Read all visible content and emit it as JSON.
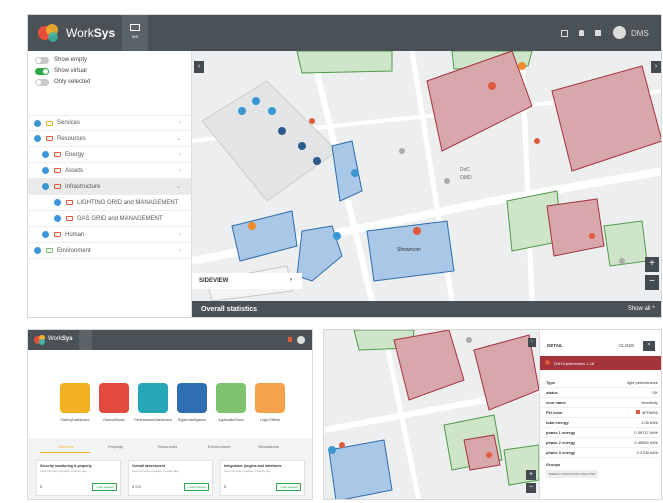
{
  "app": {
    "brand_light": "Work",
    "brand_bold": "Sys",
    "user": "DMS",
    "center_tab": "WS"
  },
  "filters": [
    {
      "label": "Show empty",
      "on": false
    },
    {
      "label": "Show virtual",
      "on": true
    },
    {
      "label": "Only selected",
      "on": false
    }
  ],
  "tree": {
    "services": "Services",
    "resources": "Resources",
    "energy": "Energy",
    "assets": "Assets",
    "infrastructure": "Infrastructure",
    "lighting": "LIGHTING GRID and MANAGEMENT",
    "gas": "GAS GRID and MANAGEMENT",
    "human": "Human",
    "environment": "Environment"
  },
  "map": {
    "sideview_label": "SIDEVIEW",
    "overall_stats": "Overall statistics",
    "show_all": "Show all",
    "zoom_in": "+",
    "zoom_out": "−",
    "labels": {
      "doc": "DoC",
      "omd": "OMD",
      "showroom": "Showroom"
    }
  },
  "dashboard": {
    "tiles": [
      {
        "label": "FactoryDashboard",
        "color": "#f0b020"
      },
      {
        "label": "FactoryStudio",
        "color": "#e24a3b"
      },
      {
        "label": "PerformanceDashboard",
        "color": "#28a7b7"
      },
      {
        "label": "Digital Intelligence",
        "color": "#2e6fb3"
      },
      {
        "label": "ApplicationStore",
        "color": "#7dc36d"
      },
      {
        "label": "Logic Effects",
        "color": "#f4a34c"
      }
    ],
    "tabs": [
      "Services",
      "Property",
      "Resources",
      "Environment",
      "Simulations"
    ],
    "cards": [
      {
        "title": "Security monitoring & property",
        "sub": "Last info was updated 3 weeks ago",
        "values": "0",
        "btn": "+ Add widgets"
      },
      {
        "title": "Overall assessment",
        "sub": "Last info was updated 3 weeks ago",
        "values": "0   0   0",
        "btn": "+ Add widgets"
      },
      {
        "title": "Integration: plugins and interfaces",
        "sub": "Last info was updated 3 weeks ago",
        "values": "0",
        "btn": "+ Add widgets"
      }
    ]
  },
  "detail": {
    "title": "DETAIL",
    "close": "CLOSE",
    "header": "D4H Kantinestrec 1.18",
    "rows": [
      {
        "k": "Type",
        "v": "light performance"
      },
      {
        "k": "status",
        "v": "OK"
      },
      {
        "k": "icon name",
        "v": "electricity"
      },
      {
        "k": "Fill color",
        "v": "#FF6600"
      },
      {
        "k": "total energy",
        "v": "1.06 kWh"
      },
      {
        "k": "phase 1 energy",
        "v": "0.39737 kWh"
      },
      {
        "k": "phase 2 energy",
        "v": "0.49652 kWh"
      },
      {
        "k": "phase 3 energy",
        "v": "0.3708 kWh"
      }
    ],
    "groups_label": "Groups",
    "groups_tag": "ENERGY ADDITIONAL ANALYSIS"
  },
  "colors": {
    "topbar": "#4a5257",
    "accent": "#3a97d4",
    "toggle_on": "#2ea84a",
    "danger": "#e05a3c"
  }
}
